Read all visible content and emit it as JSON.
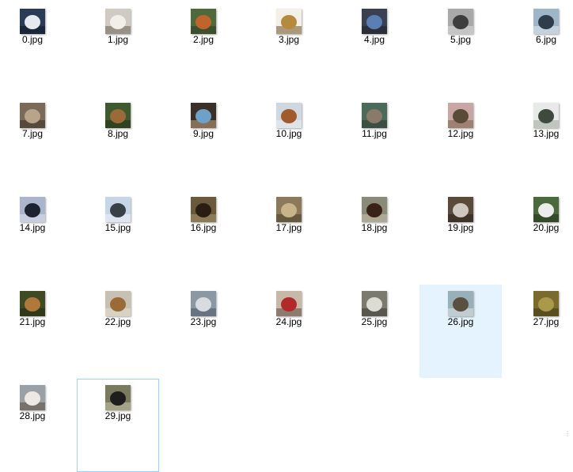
{
  "files": [
    {
      "name": "0.jpg",
      "thumb": {
        "bg": "#2b3a55",
        "fg": "#e6e9ee",
        "accent": "#0e1626"
      }
    },
    {
      "name": "1.jpg",
      "thumb": {
        "bg": "#cfcac2",
        "fg": "#f2efe9",
        "accent": "#6b6258"
      }
    },
    {
      "name": "2.jpg",
      "thumb": {
        "bg": "#4f6a3a",
        "fg": "#c0642c",
        "accent": "#2e3b22"
      }
    },
    {
      "name": "3.jpg",
      "thumb": {
        "bg": "#f3f0e8",
        "fg": "#b58a3c",
        "accent": "#6e5320"
      }
    },
    {
      "name": "4.jpg",
      "thumb": {
        "bg": "#3a4050",
        "fg": "#5a7fb5",
        "accent": "#1d2027"
      }
    },
    {
      "name": "5.jpg",
      "thumb": {
        "bg": "#a9a9a9",
        "fg": "#3e3e3e",
        "accent": "#dcdcdc"
      }
    },
    {
      "name": "6.jpg",
      "thumb": {
        "bg": "#9fb6c9",
        "fg": "#2f3d4a",
        "accent": "#e2e8ee"
      }
    },
    {
      "name": "7.jpg",
      "thumb": {
        "bg": "#7a6a58",
        "fg": "#b8a48a",
        "accent": "#3a3028"
      }
    },
    {
      "name": "8.jpg",
      "thumb": {
        "bg": "#3f5a2e",
        "fg": "#9a6a38",
        "accent": "#22301a"
      }
    },
    {
      "name": "9.jpg",
      "thumb": {
        "bg": "#3a3028",
        "fg": "#6fa0c8",
        "accent": "#c6a47a"
      }
    },
    {
      "name": "10.jpg",
      "thumb": {
        "bg": "#cfd8e0",
        "fg": "#a05a2c",
        "accent": "#e9eef2"
      }
    },
    {
      "name": "11.jpg",
      "thumb": {
        "bg": "#4c6a5a",
        "fg": "#8a7a68",
        "accent": "#2a3a30"
      }
    },
    {
      "name": "12.jpg",
      "thumb": {
        "bg": "#c9a6a6",
        "fg": "#5a4a38",
        "accent": "#7a6248"
      }
    },
    {
      "name": "13.jpg",
      "thumb": {
        "bg": "#e8eaea",
        "fg": "#3e4a3e",
        "accent": "#9aa89a"
      }
    },
    {
      "name": "14.jpg",
      "thumb": {
        "bg": "#aab4cc",
        "fg": "#1e2230",
        "accent": "#dfe4ee"
      }
    },
    {
      "name": "15.jpg",
      "thumb": {
        "bg": "#c6d6e6",
        "fg": "#3a4048",
        "accent": "#eef3f8"
      }
    },
    {
      "name": "16.jpg",
      "thumb": {
        "bg": "#6a5a3a",
        "fg": "#2a1e14",
        "accent": "#a89870"
      }
    },
    {
      "name": "17.jpg",
      "thumb": {
        "bg": "#8a7a5a",
        "fg": "#c9b48a",
        "accent": "#4a3e2a"
      }
    },
    {
      "name": "18.jpg",
      "thumb": {
        "bg": "#8a8a78",
        "fg": "#3a2218",
        "accent": "#c8c2b0"
      }
    },
    {
      "name": "19.jpg",
      "thumb": {
        "bg": "#5a4a3a",
        "fg": "#cfc8c0",
        "accent": "#2a221a"
      }
    },
    {
      "name": "20.jpg",
      "thumb": {
        "bg": "#4a6a3a",
        "fg": "#ececec",
        "accent": "#22301a"
      }
    },
    {
      "name": "21.jpg",
      "thumb": {
        "bg": "#3e4a22",
        "fg": "#b0783a",
        "accent": "#222a12"
      }
    },
    {
      "name": "22.jpg",
      "thumb": {
        "bg": "#c8c0b0",
        "fg": "#9a6a38",
        "accent": "#e6e0d4"
      }
    },
    {
      "name": "23.jpg",
      "thumb": {
        "bg": "#8a98a6",
        "fg": "#d8dcde",
        "accent": "#4a5562"
      }
    },
    {
      "name": "24.jpg",
      "thumb": {
        "bg": "#c8b8a8",
        "fg": "#b02a2a",
        "accent": "#5a4a40"
      }
    },
    {
      "name": "25.jpg",
      "thumb": {
        "bg": "#7a7a6e",
        "fg": "#dcdcd4",
        "accent": "#3a3a34"
      }
    },
    {
      "name": "26.jpg",
      "thumb": {
        "bg": "#9ab0b8",
        "fg": "#5a5040",
        "accent": "#dfe6e8"
      }
    },
    {
      "name": "27.jpg",
      "thumb": {
        "bg": "#7a6a2e",
        "fg": "#a89a4a",
        "accent": "#3e3614"
      }
    },
    {
      "name": "28.jpg",
      "thumb": {
        "bg": "#9aa0a6",
        "fg": "#ede8e2",
        "accent": "#5a4a3a"
      }
    },
    {
      "name": "29.jpg",
      "thumb": {
        "bg": "#7a7a5e",
        "fg": "#1e1e1e",
        "accent": "#c8c4a8"
      }
    }
  ],
  "selected": "26.jpg",
  "focused": "29.jpg",
  "colors": {
    "selection_bg": "#e5f3ff",
    "focus_border": "#99d1ff"
  }
}
